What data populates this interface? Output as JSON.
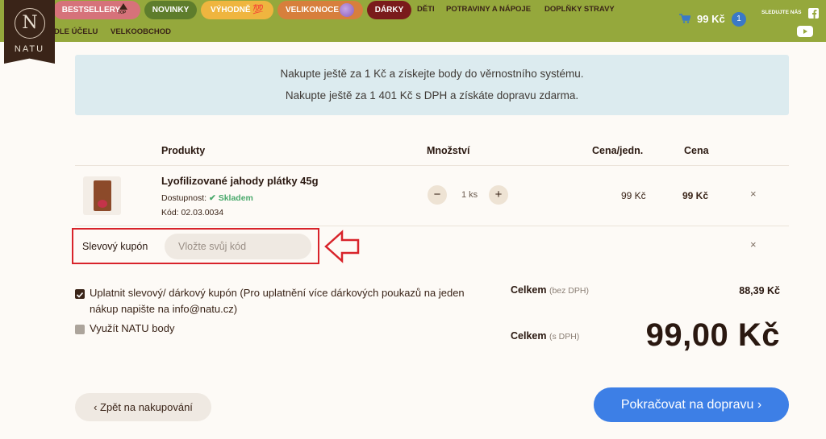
{
  "header": {
    "logo_letter": "N",
    "logo_text": "NATU",
    "nav_pills": [
      {
        "label": "BESTSELLERY",
        "bg": "#d6727a"
      },
      {
        "label": "NOVINKY",
        "bg": "#5e7d2c"
      },
      {
        "label": "VÝHODNĚ",
        "bg": "#efb53f"
      },
      {
        "label": "VELIKONOCE",
        "bg": "#d77f3c"
      },
      {
        "label": "DÁRKY",
        "bg": "#7a1b1b"
      }
    ],
    "top_badge": "TOP",
    "hundred_badge": "💯",
    "nav_links": [
      "DĚTI",
      "POTRAVINY A NÁPOJE",
      "DOPLŇKY STRAVY",
      "DLE ÚČELU",
      "VELKOOBCHOD"
    ],
    "cart_total": "99 Kč",
    "cart_count": "1",
    "follow_label": "SLEDUJTE NÁS",
    "social_icons": [
      "facebook-icon",
      "youtube-icon"
    ]
  },
  "notice": {
    "line1": "Nakupte ještě za 1 Kč a získejte body do věrnostního systému.",
    "line2": "Nakupte ještě za 1 401 Kč s DPH a získáte dopravu zdarma."
  },
  "table": {
    "headers": {
      "products": "Produkty",
      "quantity": "Množství",
      "unit_price": "Cena/jedn.",
      "price": "Cena"
    },
    "items": [
      {
        "name": "Lyofilizované jahody plátky 45g",
        "availability_label": "Dostupnost:",
        "availability_value": "Skladem",
        "code": "Kód: 02.03.0034",
        "quantity": "1 ks",
        "unit_price": "99 Kč",
        "price": "99 Kč"
      }
    ],
    "remove_icon": "×"
  },
  "coupon": {
    "label": "Slevový kupón",
    "placeholder": "Vložte svůj kód",
    "value": ""
  },
  "options": {
    "apply_coupon": "Uplatnit slevový/ dárkový kupón (Pro uplatnění více dárkových poukazů na jeden nákup napište na info@natu.cz)",
    "apply_coupon_checked": true,
    "use_points": "Využít NATU body",
    "use_points_checked": false
  },
  "totals": {
    "label": "Celkem",
    "without_vat_note": "(bez DPH)",
    "without_vat_value": "88,39 Kč",
    "with_vat_note": "(s DPH)",
    "with_vat_value": "99,00 Kč"
  },
  "actions": {
    "back": "‹  Zpět na nakupování",
    "next": "Pokračovat na dopravu  ›"
  },
  "colors": {
    "brand_green": "#95a83c",
    "brand_brown": "#3a2418",
    "accent_blue": "#3d7fe6",
    "highlight_red": "#d8232a"
  }
}
